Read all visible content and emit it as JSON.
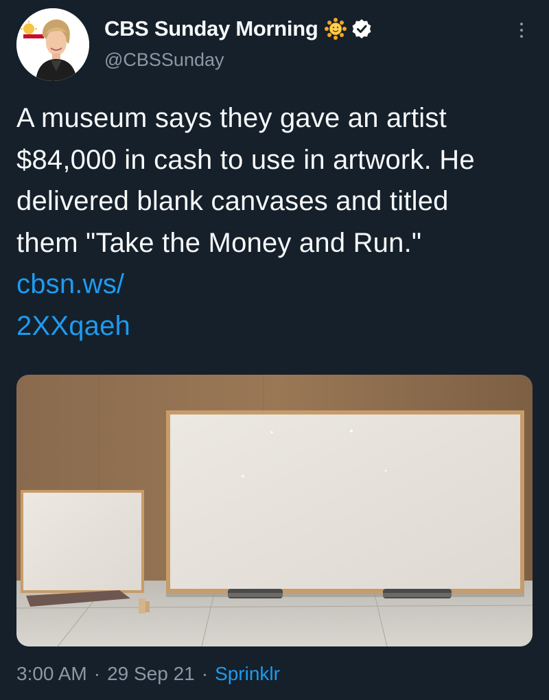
{
  "author": {
    "display_name": "CBS Sunday Morning",
    "handle": "@CBSSunday",
    "avatar_icon": "avatar-photo",
    "name_emoji_icon": "sun-emoji-icon",
    "verified_icon": "verified-badge-icon"
  },
  "tweet": {
    "text": "A museum says they gave an artist $84,000 in cash to use in artwork. He delivered blank canvases and titled them \"Take the Money and Run.\" ",
    "link": "cbsn.ws/\n2XXqaeh"
  },
  "meta": {
    "time": "3:00 AM",
    "date": "29 Sep 21",
    "source": "Sprinklr",
    "separator": "·"
  },
  "colors": {
    "background": "#15202b",
    "text": "#f7f9f9",
    "secondary_text": "#8b98a5",
    "link": "#1d9bf0"
  }
}
